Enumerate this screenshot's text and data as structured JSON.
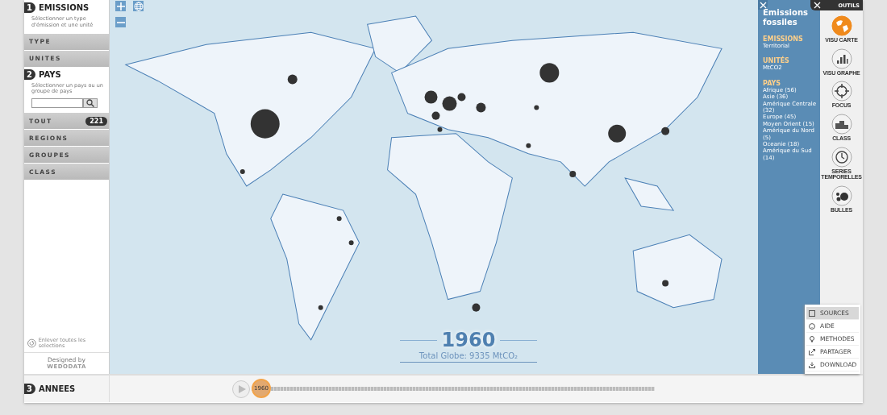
{
  "emissions": {
    "number": "1",
    "title": "EMISSIONS",
    "description": "Sélectionner un type d'émission et une unité",
    "items": [
      {
        "label": "TYPE"
      },
      {
        "label": "UNITES"
      }
    ]
  },
  "pays": {
    "number": "2",
    "title": "PAYS",
    "description": "Sélectionner un pays ou un groupe de pays",
    "items": [
      {
        "label": "TOUT",
        "count": "221"
      },
      {
        "label": "REGIONS"
      },
      {
        "label": "GROUPES"
      },
      {
        "label": "CLASS"
      }
    ]
  },
  "reset_link": "Enlever toutes les selections",
  "credit": {
    "label": "Designed by",
    "brand": "WE**DO**DATA"
  },
  "map_overlay": {
    "year": "1960",
    "total": "Total Globe: 9335 MtCO₂"
  },
  "info_panel": {
    "title": "Emissions fossiles",
    "groups": [
      {
        "heading": "EMISSIONS",
        "lines": [
          "Territorial"
        ]
      },
      {
        "heading": "UNITÉS",
        "lines": [
          "MtCO2"
        ]
      },
      {
        "heading": "PAYS",
        "lines": [
          "Afrique (56)",
          "Asie (36)",
          "Amérique Centrale (32)",
          "Europe (45)",
          "Moyen Orient (15)",
          "Amérique du Nord (5)",
          "Oceanie (18)",
          "Amérique du Sud (14)"
        ]
      }
    ]
  },
  "tools": {
    "title": "OUTILS",
    "items": [
      {
        "label": "VISU CARTE",
        "selected": true
      },
      {
        "label": "VISU GRAPHE",
        "selected": false
      },
      {
        "label": "FOCUS",
        "selected": false
      },
      {
        "label": "CLASS",
        "selected": false
      },
      {
        "label": "SERIES TEMPORELLES",
        "selected": false
      },
      {
        "label": "BULLES",
        "selected": false
      }
    ]
  },
  "menu": [
    {
      "label": "SOURCES",
      "selected": true
    },
    {
      "label": "AIDE",
      "selected": false
    },
    {
      "label": "METHODES",
      "selected": false
    },
    {
      "label": "PARTAGER",
      "selected": false
    },
    {
      "label": "DOWNLOAD",
      "selected": false
    }
  ],
  "timeline": {
    "number": "3",
    "title": "ANNEES",
    "year": "1960",
    "level": 0
  }
}
